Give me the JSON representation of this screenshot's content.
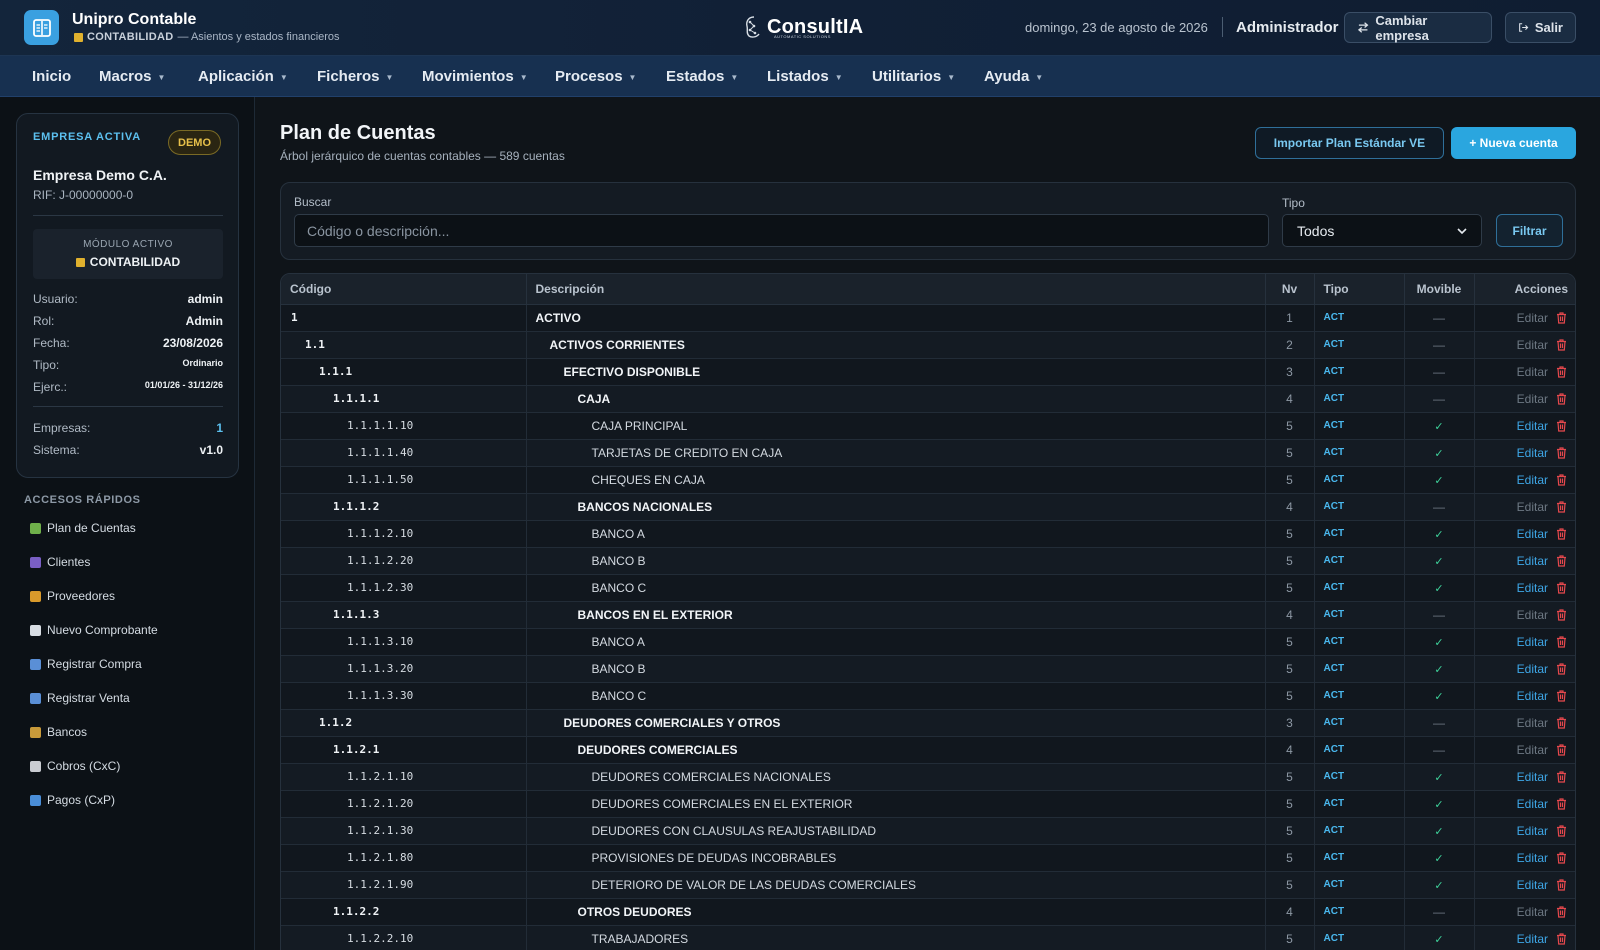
{
  "header": {
    "app_title": "Unipro Contable",
    "module": "CONTABILIDAD",
    "module_desc": "— Asientos y estados financieros",
    "brand": "ConsultIA",
    "brand_tag": "AUTOMATIC SOLUTIONS",
    "date": "domingo, 23 de agosto de 2026",
    "user": "Administrador",
    "change_company": "Cambiar empresa",
    "logout": "Salir"
  },
  "nav": {
    "items": [
      {
        "label": "Inicio"
      },
      {
        "label": "Macros"
      },
      {
        "label": "Aplicación"
      },
      {
        "label": "Ficheros"
      },
      {
        "label": "Movimientos"
      },
      {
        "label": "Procesos"
      },
      {
        "label": "Estados"
      },
      {
        "label": "Listados"
      },
      {
        "label": "Utilitarios"
      },
      {
        "label": "Ayuda"
      }
    ]
  },
  "sidebar": {
    "card_label": "EMPRESA ACTIVA",
    "badge": "DEMO",
    "company_name": "Empresa Demo C.A.",
    "rif": "RIF: J-00000000-0",
    "module_label": "MÓDULO ACTIVO",
    "module_value": "CONTABILIDAD",
    "info": [
      {
        "k": "Usuario:",
        "v": "admin"
      },
      {
        "k": "Rol:",
        "v": "Admin"
      },
      {
        "k": "Fecha:",
        "v": "23/08/2026"
      },
      {
        "k": "Tipo:",
        "v": "Ordinario"
      },
      {
        "k": "Ejerc.:",
        "v": "01/01/26 - 31/12/26"
      }
    ],
    "stats": [
      {
        "k": "Empresas:",
        "v": "1"
      },
      {
        "k": "Sistema:",
        "v": "v1.0"
      }
    ],
    "quick_title": "ACCESOS RÁPIDOS",
    "quick": [
      {
        "label": "Plan de Cuentas",
        "color": "#6fb04a"
      },
      {
        "label": "Clientes",
        "color": "#7a5fc4"
      },
      {
        "label": "Proveedores",
        "color": "#d99a2b"
      },
      {
        "label": "Nuevo Comprobante",
        "color": "#d8dde3"
      },
      {
        "label": "Registrar Compra",
        "color": "#5a8fd6"
      },
      {
        "label": "Registrar Venta",
        "color": "#5a8fd6"
      },
      {
        "label": "Bancos",
        "color": "#c89a3a"
      },
      {
        "label": "Cobros (CxC)",
        "color": "#c9ccd1"
      },
      {
        "label": "Pagos (CxP)",
        "color": "#4a8ed8"
      }
    ]
  },
  "main": {
    "title": "Plan de Cuentas",
    "subtitle": "Árbol jerárquico de cuentas contables — 589 cuentas",
    "import_btn": "Importar Plan Estándar VE",
    "new_btn": "+ Nueva cuenta",
    "search_label": "Buscar",
    "search_placeholder": "Código o descripción...",
    "type_label": "Tipo",
    "type_value": "Todos",
    "filter_btn": "Filtrar"
  },
  "table": {
    "headers": {
      "code": "Código",
      "desc": "Descripción",
      "nv": "Nv",
      "tipo": "Tipo",
      "mov": "Movible",
      "acc": "Acciones"
    },
    "edit_label": "Editar",
    "rows": [
      {
        "code": "1",
        "desc": "ACTIVO",
        "nv": "1",
        "tipo": "ACT",
        "mov": false
      },
      {
        "code": "1.1",
        "desc": "ACTIVOS CORRIENTES",
        "nv": "2",
        "tipo": "ACT",
        "mov": false
      },
      {
        "code": "1.1.1",
        "desc": "EFECTIVO DISPONIBLE",
        "nv": "3",
        "tipo": "ACT",
        "mov": false
      },
      {
        "code": "1.1.1.1",
        "desc": "CAJA",
        "nv": "4",
        "tipo": "ACT",
        "mov": false
      },
      {
        "code": "1.1.1.1.10",
        "desc": "CAJA PRINCIPAL",
        "nv": "5",
        "tipo": "ACT",
        "mov": true
      },
      {
        "code": "1.1.1.1.40",
        "desc": "TARJETAS DE CREDITO EN CAJA",
        "nv": "5",
        "tipo": "ACT",
        "mov": true
      },
      {
        "code": "1.1.1.1.50",
        "desc": "CHEQUES EN CAJA",
        "nv": "5",
        "tipo": "ACT",
        "mov": true
      },
      {
        "code": "1.1.1.2",
        "desc": "BANCOS NACIONALES",
        "nv": "4",
        "tipo": "ACT",
        "mov": false
      },
      {
        "code": "1.1.1.2.10",
        "desc": "BANCO A",
        "nv": "5",
        "tipo": "ACT",
        "mov": true
      },
      {
        "code": "1.1.1.2.20",
        "desc": "BANCO B",
        "nv": "5",
        "tipo": "ACT",
        "mov": true
      },
      {
        "code": "1.1.1.2.30",
        "desc": "BANCO C",
        "nv": "5",
        "tipo": "ACT",
        "mov": true
      },
      {
        "code": "1.1.1.3",
        "desc": "BANCOS EN EL EXTERIOR",
        "nv": "4",
        "tipo": "ACT",
        "mov": false
      },
      {
        "code": "1.1.1.3.10",
        "desc": "BANCO A",
        "nv": "5",
        "tipo": "ACT",
        "mov": true
      },
      {
        "code": "1.1.1.3.20",
        "desc": "BANCO B",
        "nv": "5",
        "tipo": "ACT",
        "mov": true
      },
      {
        "code": "1.1.1.3.30",
        "desc": "BANCO C",
        "nv": "5",
        "tipo": "ACT",
        "mov": true
      },
      {
        "code": "1.1.2",
        "desc": "DEUDORES COMERCIALES Y OTROS",
        "nv": "3",
        "tipo": "ACT",
        "mov": false
      },
      {
        "code": "1.1.2.1",
        "desc": "DEUDORES COMERCIALES",
        "nv": "4",
        "tipo": "ACT",
        "mov": false
      },
      {
        "code": "1.1.2.1.10",
        "desc": "DEUDORES COMERCIALES NACIONALES",
        "nv": "5",
        "tipo": "ACT",
        "mov": true
      },
      {
        "code": "1.1.2.1.20",
        "desc": "DEUDORES COMERCIALES EN EL EXTERIOR",
        "nv": "5",
        "tipo": "ACT",
        "mov": true
      },
      {
        "code": "1.1.2.1.30",
        "desc": "DEUDORES CON CLAUSULAS REAJUSTABILIDAD",
        "nv": "5",
        "tipo": "ACT",
        "mov": true
      },
      {
        "code": "1.1.2.1.80",
        "desc": "PROVISIONES DE DEUDAS INCOBRABLES",
        "nv": "5",
        "tipo": "ACT",
        "mov": true
      },
      {
        "code": "1.1.2.1.90",
        "desc": "DETERIORO DE VALOR DE LAS DEUDAS COMERCIALES",
        "nv": "5",
        "tipo": "ACT",
        "mov": true
      },
      {
        "code": "1.1.2.2",
        "desc": "OTROS DEUDORES",
        "nv": "4",
        "tipo": "ACT",
        "mov": false
      },
      {
        "code": "1.1.2.2.10",
        "desc": "TRABAJADORES",
        "nv": "5",
        "tipo": "ACT",
        "mov": true
      }
    ]
  },
  "colors": {
    "accent": "#2aa6df",
    "link": "#3ea6e6",
    "check": "#3ed19a",
    "delete": "#e5484d",
    "module": "#e0b12e"
  }
}
